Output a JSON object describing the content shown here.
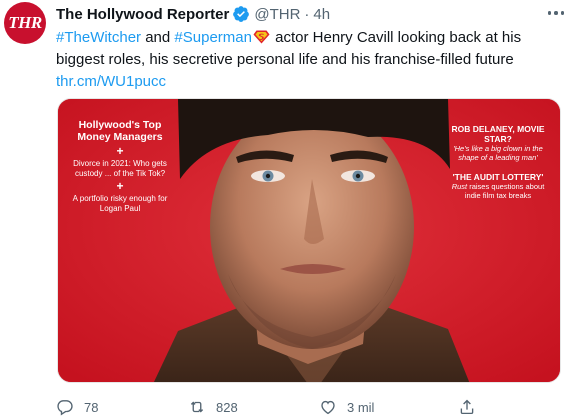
{
  "author": {
    "display_name": "The Hollywood Reporter",
    "handle": "@THR",
    "separator": "·",
    "timestamp": "4h",
    "avatar_text": "THR",
    "verified_icon": "verified-badge-icon"
  },
  "tweet": {
    "hashtag_1": "#TheWitcher",
    "and_text": " and ",
    "hashtag_2": "#Superman",
    "emoji_icon": "superman-shield-emoji",
    "text_rest": " actor Henry Cavill looking back at his biggest roles, his secretive personal life and his franchise-filled future",
    "link": "thr.cm/WU1pucc"
  },
  "media": {
    "left_headline": "Hollywood's Top Money Managers",
    "plus": "+",
    "left_item_1": "Divorce in 2021: Who gets custody ... of the Tik Tok?",
    "left_item_2": "A portfolio risky enough for Logan Paul",
    "right_headline_1": "ROB DELANEY, MOVIE STAR?",
    "right_sub_1": "'He's like a big clown in the shape of a leading man'",
    "right_headline_2": "'THE AUDIT LOTTERY'",
    "right_sub_2_italic": "Rust",
    "right_sub_2": " raises questions about indie film tax breaks",
    "background_color": "#d6202c"
  },
  "actions": {
    "reply_count": "78",
    "retweet_count": "828",
    "like_count": "3 mil",
    "reply_icon": "reply-icon",
    "retweet_icon": "retweet-icon",
    "like_icon": "heart-icon",
    "share_icon": "share-icon"
  },
  "colors": {
    "link_blue": "#1d9bf0",
    "secondary_text": "#536471",
    "brand_red": "#c8102e"
  }
}
